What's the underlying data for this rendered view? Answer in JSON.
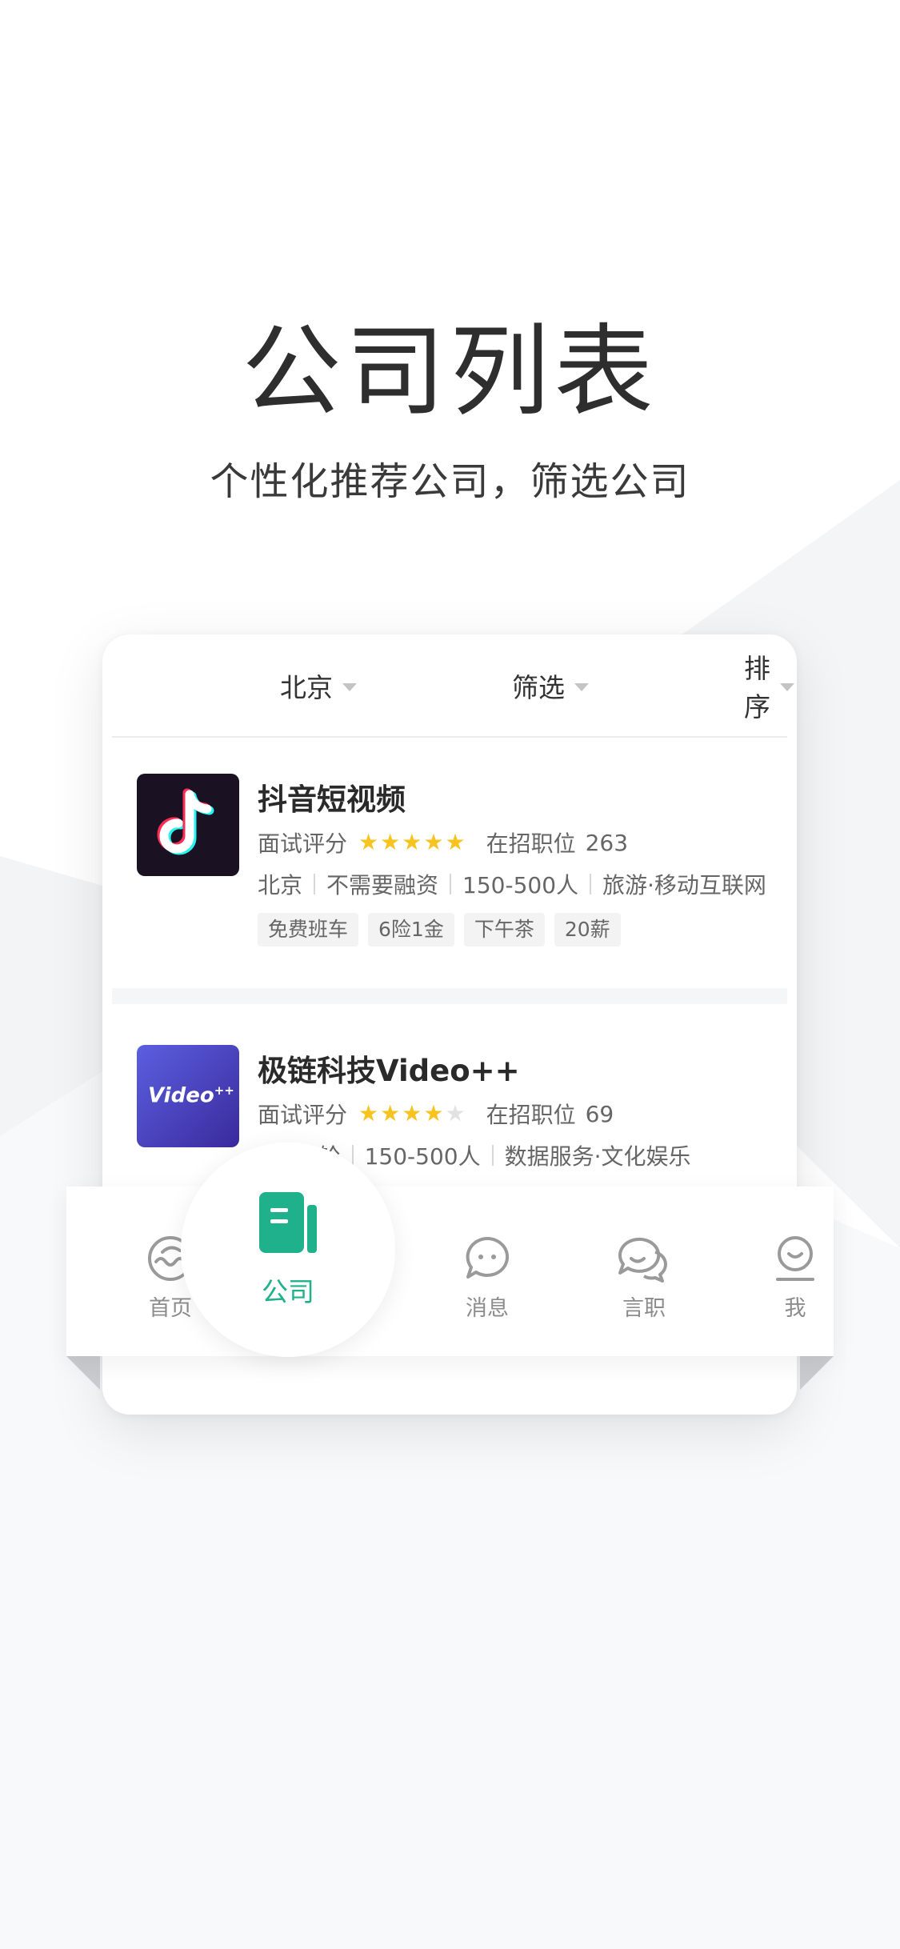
{
  "hero": {
    "title": "公司列表",
    "subtitle": "个性化推荐公司，筛选公司"
  },
  "filters": [
    {
      "label": "北京"
    },
    {
      "label": "筛选"
    },
    {
      "label": "排序"
    }
  ],
  "companies": [
    {
      "name": "抖音短视频",
      "rating_label": "面试评分",
      "rating": 5,
      "jobs_label": "在招职位",
      "jobs_count": "263",
      "city": "北京",
      "funding": "不需要融资",
      "size": "150-500人",
      "industry": "旅游·移动互联网",
      "tags": [
        "免费班车",
        "6险1金",
        "下午茶",
        "20薪"
      ],
      "logo_icon": "tiktok-logo-icon"
    },
    {
      "name": "极链科技Video++",
      "rating_label": "面试评分",
      "rating": 4,
      "jobs_label": "在招职位",
      "jobs_count": "69",
      "partial": "C轮",
      "size": "150-500人",
      "industry": "数据服务·文化娱乐",
      "logo_text": "Video",
      "logo_sup": "++",
      "logo_icon": "video-plus-logo-icon"
    }
  ],
  "tabs": [
    {
      "label": "首页",
      "icon": "home-wave-icon"
    },
    {
      "label": "公司",
      "icon": "company-book-icon",
      "active": true
    },
    {
      "label": "消息",
      "icon": "message-bubble-icon"
    },
    {
      "label": "言职",
      "icon": "discuss-bubbles-icon"
    },
    {
      "label": "我",
      "icon": "profile-face-icon"
    }
  ],
  "colors": {
    "accent": "#1fb08c",
    "star": "#f7c41f",
    "text_primary": "#2a2a2a",
    "text_secondary": "#666666"
  }
}
